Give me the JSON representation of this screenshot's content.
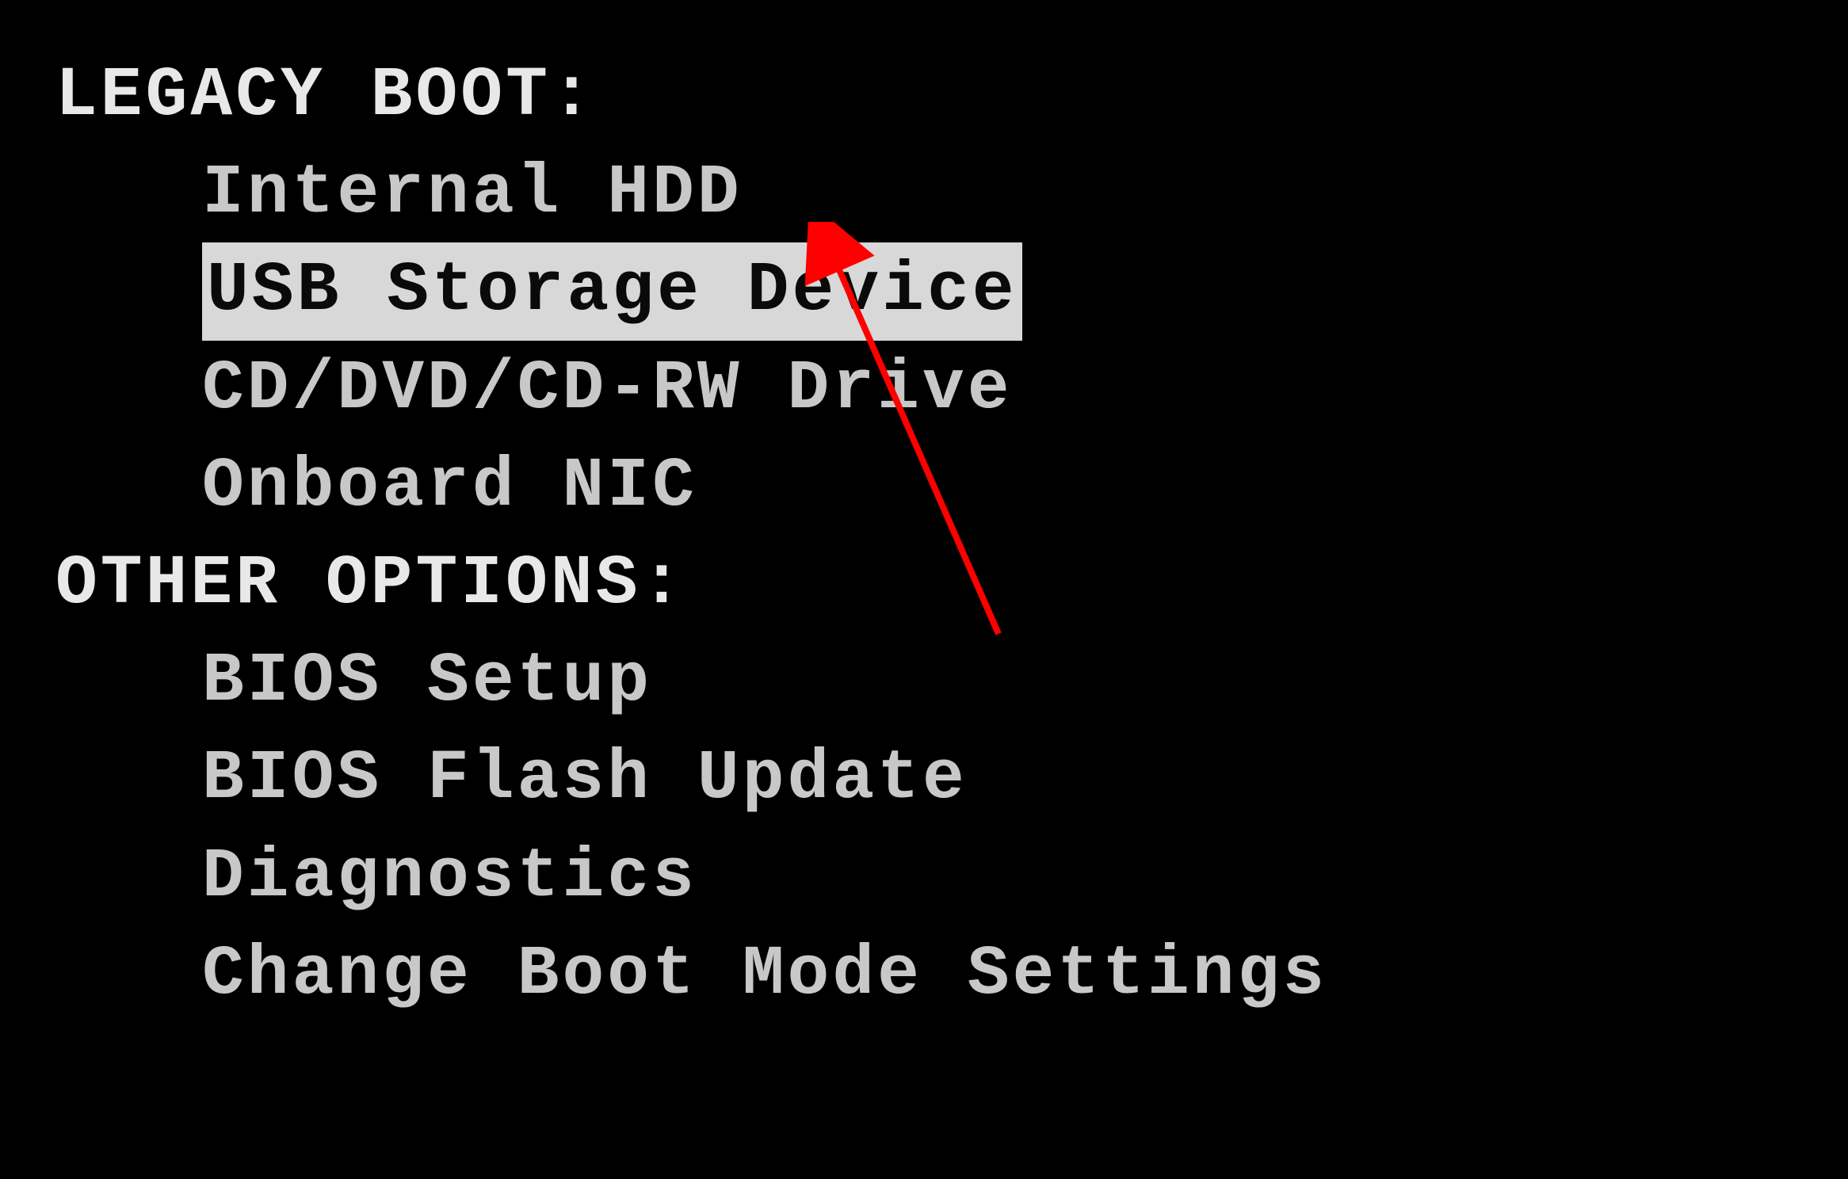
{
  "sections": {
    "legacy_boot": {
      "header": "LEGACY BOOT:",
      "items": [
        {
          "label": "Internal HDD",
          "selected": false
        },
        {
          "label": "USB Storage Device",
          "selected": true
        },
        {
          "label": "CD/DVD/CD-RW Drive",
          "selected": false
        },
        {
          "label": "Onboard NIC",
          "selected": false
        }
      ]
    },
    "other_options": {
      "header": "OTHER OPTIONS:",
      "items": [
        {
          "label": "BIOS Setup",
          "selected": false
        },
        {
          "label": "BIOS Flash Update",
          "selected": false
        },
        {
          "label": "Diagnostics",
          "selected": false
        },
        {
          "label": "Change Boot Mode Settings",
          "selected": false
        }
      ]
    }
  },
  "annotation": {
    "arrow_color": "#ff0000"
  }
}
